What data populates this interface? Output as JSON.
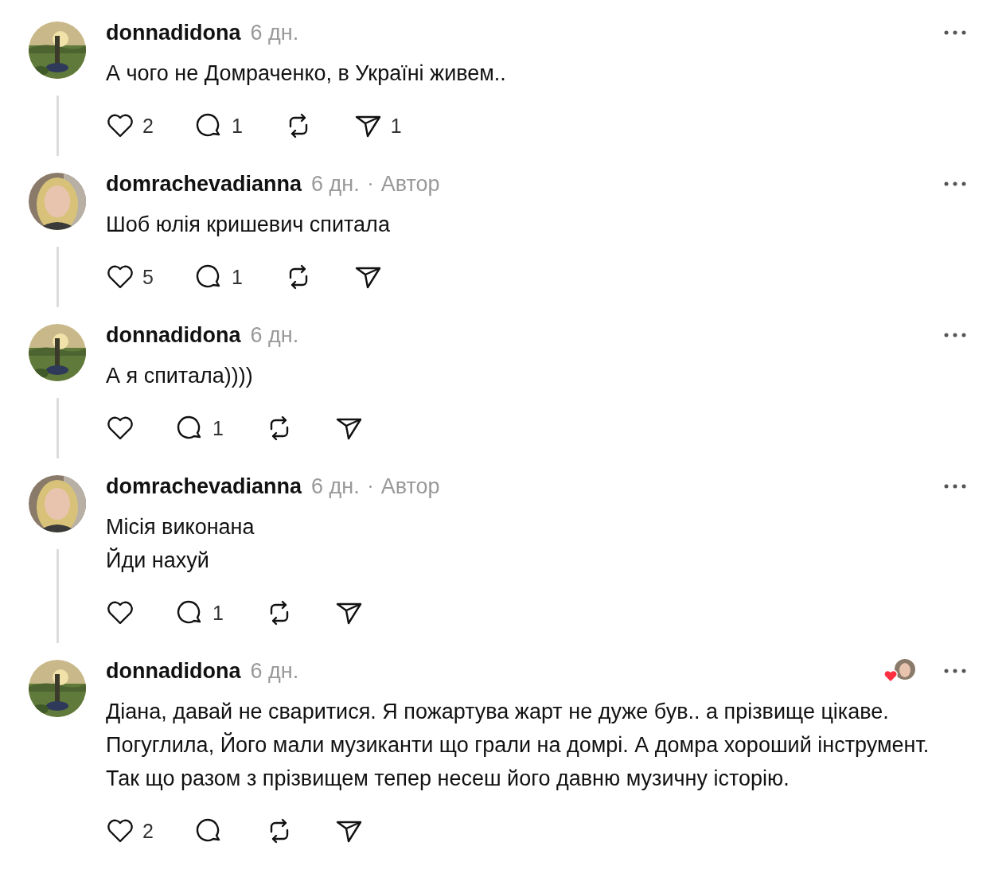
{
  "posts": [
    {
      "author": "donnadidona",
      "time": "6 дн.",
      "avatar": {
        "kind": "landscape"
      },
      "text": "А чого не Домраченко, в Україні живем..",
      "thread_line": true,
      "actions": {
        "likes": "2",
        "replies": "1",
        "shares": "1"
      }
    },
    {
      "author": "domrachevadianna",
      "time": "6 дн.",
      "badge": "Автор",
      "avatar": {
        "kind": "person"
      },
      "text": "Шоб юлія кришевич спитала",
      "thread_line": true,
      "actions": {
        "likes": "5",
        "replies": "1"
      }
    },
    {
      "author": "donnadidona",
      "time": "6 дн.",
      "avatar": {
        "kind": "landscape"
      },
      "text": "А я спитала))))",
      "thread_line": true,
      "actions": {
        "replies": "1"
      }
    },
    {
      "author": "domrachevadianna",
      "time": "6 дн.",
      "badge": "Автор",
      "avatar": {
        "kind": "person"
      },
      "text": "Місія виконана\nЙди нахуй",
      "thread_line": true,
      "actions": {
        "replies": "1"
      }
    },
    {
      "author": "donnadidona",
      "time": "6 дн.",
      "avatar": {
        "kind": "landscape"
      },
      "liked_by_author": true,
      "text": "Діана, давай не сваритися. Я пожартува жарт не дуже був.. а прізвище цікаве. Погуглила, Його мали музиканти що грали на домрі. А домра хороший інструмент. Так що разом з прізвищем тепер несеш його давню музичну історію.",
      "thread_line": false,
      "actions": {
        "likes": "2"
      }
    }
  ]
}
